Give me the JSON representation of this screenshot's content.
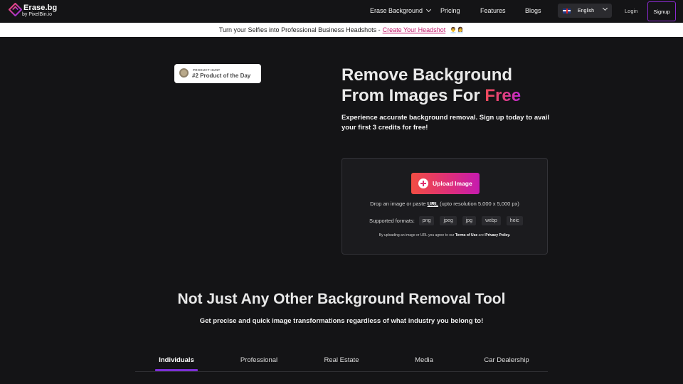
{
  "brand": {
    "name": "Erase.bg",
    "byline": "by PixelBin.io",
    "colors": {
      "accent_purple": "#8a2ad1",
      "accent_pink": "#e0306f",
      "accent_red": "#f24d43"
    }
  },
  "nav": {
    "dropdown": "Erase Background",
    "links": [
      "Pricing",
      "Features",
      "Blogs"
    ],
    "language": "English",
    "login": "Login",
    "signup": "Signup"
  },
  "banner": {
    "text": "Turn your Selfies into Professional Business Headshots - ",
    "link": "Create Your Headshot",
    "emoji": "👨‍💼👩‍💼"
  },
  "product_hunt": {
    "small": "PRODUCT HUNT",
    "big": "#2 Product of the Day"
  },
  "hero": {
    "title_line1": "Remove Background",
    "title_line2_prefix": "From Images For ",
    "title_highlight": "Free",
    "subtitle": "Experience accurate background removal. Sign up today to avail your first 3 credits for free!"
  },
  "upload": {
    "button": "Upload Image",
    "drop_prefix": "Drop an image or paste ",
    "drop_url": "URL",
    "drop_suffix": " (upto resolution 5,000 x 5,000 px)",
    "formats_label": "Supported formats:",
    "formats": [
      "png",
      "jpeg",
      "jpg",
      "webp",
      "heic"
    ],
    "terms_prefix": "By uploading an image or URL you agree to our ",
    "terms_link": "Terms of Use",
    "terms_and": " and ",
    "privacy_link": "Privacy Policy."
  },
  "section2": {
    "title": "Not Just Any Other Background Removal Tool",
    "subtitle": "Get precise and quick image transformations regardless of what industry you belong to!",
    "tabs": [
      "Individuals",
      "Professional",
      "Real Estate",
      "Media",
      "Car Dealership"
    ],
    "active_tab": "Individuals"
  }
}
